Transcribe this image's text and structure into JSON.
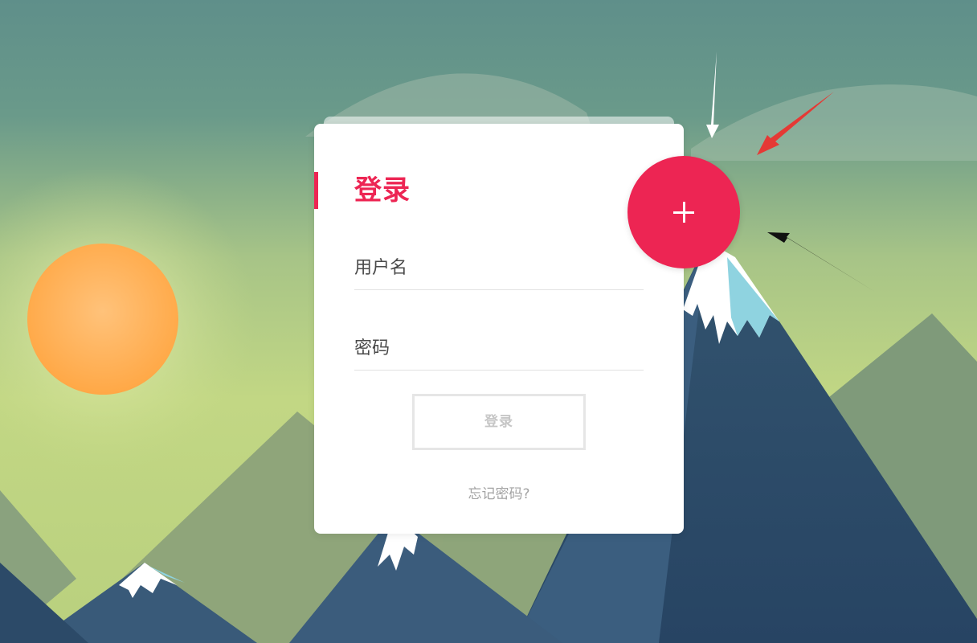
{
  "login": {
    "title": "登录",
    "username_placeholder": "用户名",
    "password_placeholder": "密码",
    "submit_label": "登录",
    "forgot_label": "忘记密码?"
  },
  "fab": {
    "icon": "plus-icon"
  },
  "colors": {
    "accent": "#ed2553",
    "sky_top": "#5f8f8a",
    "sky_mid": "#9db98a",
    "sun": "#ffae4f",
    "mountain_dark": "#2e4d6c",
    "mountain_mid": "#3c5e7d",
    "snow": "#ffffff",
    "snow_blue": "#8fd3e0",
    "arrow_white": "#ffffff",
    "arrow_red": "#e53935",
    "arrow_black": "#111111"
  }
}
